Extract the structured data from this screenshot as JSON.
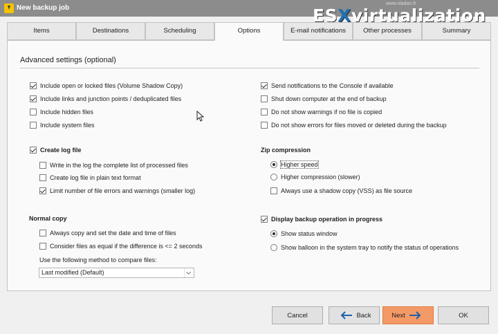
{
  "window": {
    "title": "New backup job"
  },
  "watermark": {
    "domain": "www.vladan.fr",
    "logo_main": "ES",
    "logo_x": "X",
    "logo_rest": "virtualization"
  },
  "tabs": [
    {
      "label": "Items"
    },
    {
      "label": "Destinations"
    },
    {
      "label": "Scheduling"
    },
    {
      "label": "Options",
      "active": true
    },
    {
      "label": "E-mail notifications"
    },
    {
      "label": "Other processes"
    },
    {
      "label": "Summary"
    }
  ],
  "panel": {
    "title": "Advanced settings (optional)",
    "left_options": [
      {
        "label": "Include open or locked files (Volume Shadow Copy)",
        "checked": true
      },
      {
        "label": "Include links and junction points / deduplicated files",
        "checked": true
      },
      {
        "label": "Include hidden files",
        "checked": false
      },
      {
        "label": "Include system files",
        "checked": false
      }
    ],
    "right_options": [
      {
        "label": "Send notifications to the Console if available",
        "checked": true
      },
      {
        "label": "Shut down computer at the end of backup",
        "checked": false
      },
      {
        "label": "Do not show warnings if no file is copied",
        "checked": false
      },
      {
        "label": "Do not show errors for files moved or deleted during the backup",
        "checked": false
      }
    ],
    "log": {
      "label": "Create log file",
      "checked": true,
      "options": [
        {
          "label": "Write in the log the complete list of processed files",
          "checked": false
        },
        {
          "label": "Create log file in plain text format",
          "checked": false
        },
        {
          "label": "Limit number of file errors and warnings (smaller log)",
          "checked": true
        }
      ]
    },
    "zip": {
      "heading": "Zip compression",
      "radios": [
        {
          "label": "Higher speed",
          "checked": true
        },
        {
          "label": "Higher compression (slower)",
          "checked": false
        }
      ],
      "shadow": {
        "label": "Always use a shadow copy (VSS) as file source",
        "checked": false
      }
    },
    "normal_copy": {
      "heading": "Normal copy",
      "options": [
        {
          "label": "Always copy and set the date and time of files",
          "checked": false
        },
        {
          "label": "Consider files as equal if the difference is <= 2 seconds",
          "checked": false
        }
      ],
      "compare_label": "Use the following method to compare files:",
      "compare_value": "Last modified (Default)"
    },
    "progress": {
      "label": "Display backup operation in progress",
      "checked": true,
      "radios": [
        {
          "label": "Show status window",
          "checked": true
        },
        {
          "label": "Show balloon in the system tray to notify the status of operations",
          "checked": false
        }
      ]
    }
  },
  "footer": {
    "cancel": "Cancel",
    "back": "Back",
    "next": "Next",
    "ok": "OK"
  },
  "colors": {
    "titlebar": "#8c8c8c",
    "next_button": "#f49a66",
    "arrow": "#1f5fa8",
    "logo_x": "#1f6fb5"
  }
}
